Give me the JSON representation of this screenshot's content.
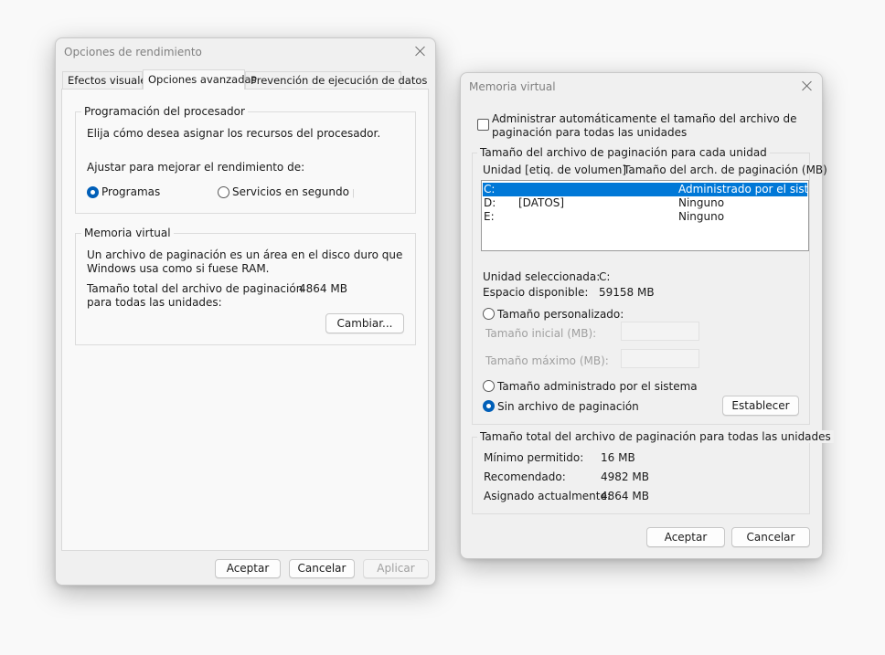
{
  "perf_dialog": {
    "title": "Opciones de rendimiento",
    "tabs": [
      {
        "label": "Efectos visuales"
      },
      {
        "label": "Opciones avanzadas"
      },
      {
        "label": "Prevención de ejecución de datos"
      }
    ],
    "processor_group": {
      "title": "Programación del procesador",
      "description": "Elija cómo desea asignar los recursos del procesador.",
      "adjust_label": "Ajustar para mejorar el rendimiento de:",
      "option_programs": "Programas",
      "option_services": "Servicios en segundo plar",
      "selected": "Programas"
    },
    "vm_group": {
      "title": "Memoria virtual",
      "description_line1": "Un archivo de paginación es un área en el disco duro que",
      "description_line2": "Windows usa como si fuese RAM.",
      "total_label_line1": "Tamaño total del archivo de paginación",
      "total_label_line2": "para todas las unidades:",
      "total_value": "4864 MB",
      "change_button": "Cambiar..."
    },
    "buttons": {
      "ok": "Aceptar",
      "cancel": "Cancelar",
      "apply": "Aplicar"
    }
  },
  "vm_dialog": {
    "title": "Memoria virtual",
    "auto_manage_line1": "Administrar automáticamente el tamaño del archivo de",
    "auto_manage_line2": "paginación para todas las unidades",
    "auto_manage_checked": false,
    "per_drive_group": {
      "title": "Tamaño del archivo de paginación para cada unidad",
      "col_drive": "Unidad [etiq. de volumen]",
      "col_size": "Tamaño del arch. de paginación (MB)",
      "rows": [
        {
          "drive": "C:",
          "label": "",
          "size": "Administrado por el sistem",
          "selected": true
        },
        {
          "drive": "D:",
          "label": "[DATOS]",
          "size": "Ninguno",
          "selected": false
        },
        {
          "drive": "E:",
          "label": "",
          "size": "Ninguno",
          "selected": false
        }
      ],
      "selected_drive_label": "Unidad seleccionada:",
      "selected_drive_value": "C:",
      "free_space_label": "Espacio disponible:",
      "free_space_value": "59158 MB",
      "custom_size_option": "Tamaño personalizado:",
      "initial_size_label": "Tamaño inicial (MB):",
      "initial_size_value": "",
      "max_size_label": "Tamaño máximo (MB):",
      "max_size_value": "",
      "system_managed_option": "Tamaño administrado por el sistema",
      "no_paging_option": "Sin archivo de paginación",
      "selected_option": "Sin archivo de paginación",
      "set_button": "Establecer"
    },
    "total_group": {
      "title": "Tamaño total del archivo de paginación para todas las unidades",
      "min_label": "Mínimo permitido:",
      "min_value": "16 MB",
      "recommended_label": "Recomendado:",
      "recommended_value": "4982 MB",
      "allocated_label": "Asignado actualmente:",
      "allocated_value": "4864 MB"
    },
    "buttons": {
      "ok": "Aceptar",
      "cancel": "Cancelar"
    }
  },
  "colors": {
    "accent": "#005fb8",
    "selection": "#0078d7"
  }
}
